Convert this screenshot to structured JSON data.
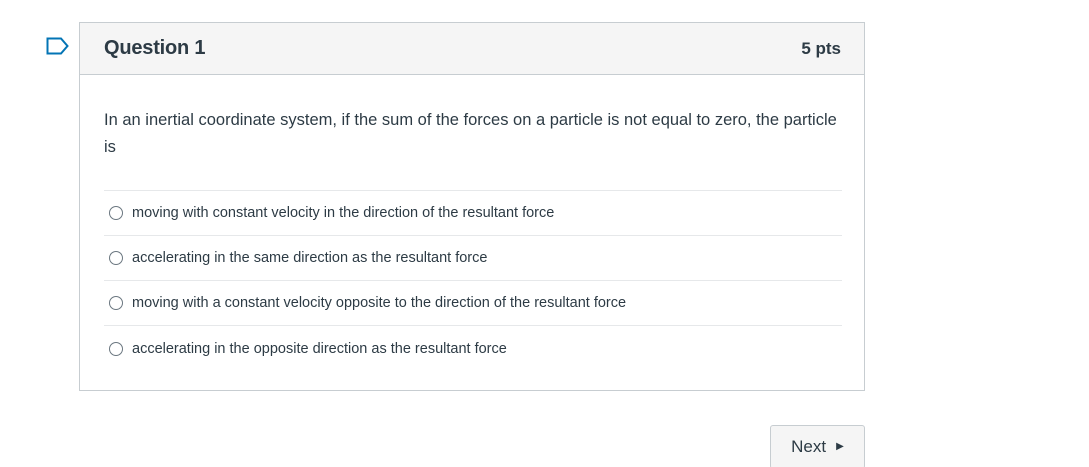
{
  "question": {
    "title": "Question 1",
    "points": "5 pts",
    "text": "In an inertial coordinate system, if the sum of the forces on a particle is not equal to zero, the particle is",
    "answers": [
      {
        "label": "moving with constant velocity in the direction of the resultant force"
      },
      {
        "label": "accelerating in the same direction as the resultant force"
      },
      {
        "label": "moving with a constant velocity opposite to the direction of the resultant force"
      },
      {
        "label": "accelerating in the opposite direction as the resultant force"
      }
    ]
  },
  "navigation": {
    "next_label": "Next",
    "next_icon": "play-right-icon"
  },
  "icons": {
    "flag": "bookmark-flag-icon"
  },
  "colors": {
    "flag": "#0374b5",
    "text": "#2d3b45",
    "border": "#c7cdd1",
    "header_bg": "#f5f5f5"
  }
}
